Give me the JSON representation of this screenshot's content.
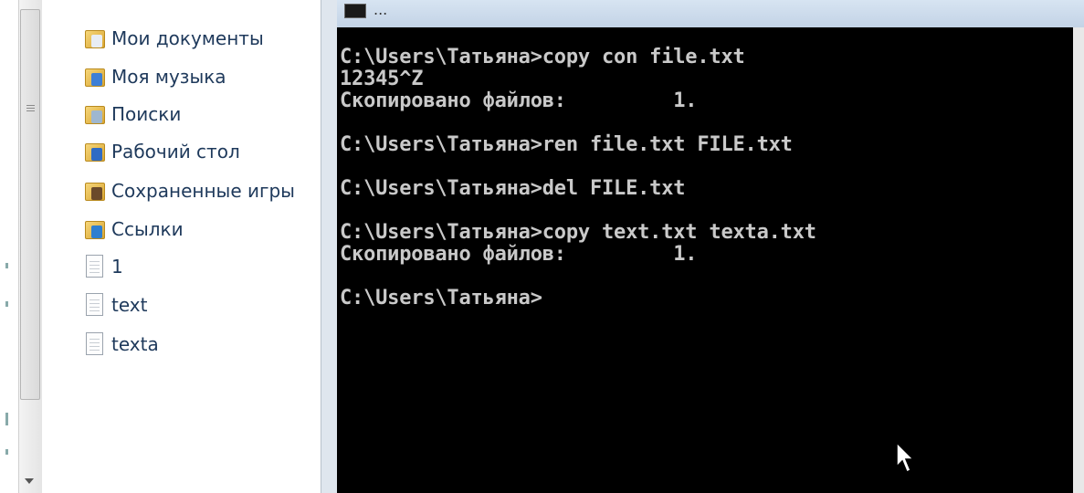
{
  "explorer": {
    "nav_items": [
      {
        "label": "Мои документы",
        "icon": "documents-folder-icon",
        "kind": "folder",
        "badge_color": "#e8edf4"
      },
      {
        "label": "Моя музыка",
        "icon": "music-folder-icon",
        "kind": "folder",
        "badge_color": "#3d7fd6"
      },
      {
        "label": "Поиски",
        "icon": "searches-folder-icon",
        "kind": "folder",
        "badge_color": "#9fb7cf"
      },
      {
        "label": "Рабочий стол",
        "icon": "desktop-folder-icon",
        "kind": "folder",
        "badge_color": "#2f6bc4"
      },
      {
        "label": "Сохраненные игры",
        "icon": "saved-games-folder-icon",
        "kind": "folder",
        "badge_color": "#6b4a2a"
      },
      {
        "label": "Ссылки",
        "icon": "links-folder-icon",
        "kind": "folder",
        "badge_color": "#2f7fd0"
      },
      {
        "label": "1",
        "icon": "text-file-icon",
        "kind": "file"
      },
      {
        "label": "text",
        "icon": "text-file-icon",
        "kind": "file"
      },
      {
        "label": "texta",
        "icon": "text-file-icon",
        "kind": "file"
      }
    ]
  },
  "cmd": {
    "title_partial": "...",
    "background": "#000000",
    "text_color": "#c9c9c9",
    "lines": [
      "C:\\Users\\Татьяна>copy con file.txt",
      "12345^Z",
      "Скопировано файлов:         1.",
      "",
      "C:\\Users\\Татьяна>ren file.txt FILE.txt",
      "",
      "C:\\Users\\Татьяна>del FILE.txt",
      "",
      "C:\\Users\\Татьяна>copy text.txt texta.txt",
      "Скопировано файлов:         1.",
      "",
      "C:\\Users\\Татьяна>"
    ]
  }
}
